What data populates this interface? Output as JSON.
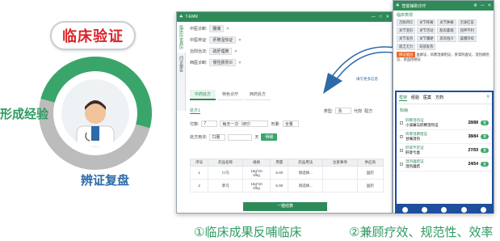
{
  "slide": {
    "title": "临床验证",
    "label_left": "形成经验",
    "label_bottom": "辨证复盘",
    "caption1": "①临床成果反哺临床",
    "caption2": "②兼顾疗效、规范性、效率"
  },
  "main_window": {
    "title": "T-EMR",
    "vtabs": [
      "临床历史病历",
      "问诊报告"
    ],
    "fields": [
      {
        "label": "中医诊断:",
        "value": "腹痛"
      },
      {
        "label": "中医辨证:",
        "value": "肝脾湿热证"
      },
      {
        "label": "治则治法:",
        "value": "疏肝理脾"
      },
      {
        "label": "西医诊断:",
        "value": "慢性肠胃炎"
      }
    ],
    "more_link": "填写更多信息",
    "rx_tabs": [
      "中药处方",
      "特色诊疗",
      "西药处方"
    ],
    "rx_label": "处方1",
    "type_label": "类型:",
    "type_value": "汤",
    "opts": [
      "代煎",
      "配方"
    ],
    "dose_label": "付数:",
    "dose_value": "7",
    "freq_label": "每天一次（8时）",
    "amount_label": "剂量:",
    "amount_value": "全量",
    "usage_label": "处方用法:",
    "usage_value": "口服",
    "days_label": "天",
    "add_btn": "明细",
    "columns": [
      "序号",
      "药品名称",
      "规格",
      "用量",
      "药品用法",
      "注意事项",
      "供应商"
    ],
    "rows": [
      {
        "no": "1",
        "name": "川乌",
        "spec": "15g*10\n0/kg",
        "qty": "6.00",
        "usage": "请选择...",
        "note": "",
        "vendor": "国药"
      },
      {
        "no": "2",
        "name": "草乌",
        "spec": "15g*10\n0/kg",
        "qty": "6.00",
        "usage": "请选择...",
        "note": "",
        "vendor": "国药"
      }
    ],
    "confirm_btn": "一键结算"
  },
  "right_window": {
    "title": "智能辅助诊疗",
    "section": "临床表现",
    "tags": [
      "舌脉四诊",
      "关节疼痛",
      "关节肿痛",
      "舌质红苔",
      "关节变形",
      "关节活动",
      "肌肉萎缩",
      "屈伸不利",
      "关节发热",
      "关节僵硬",
      "恶风怕冷",
      "晨僵持续",
      "疲乏无力",
      "局部发热"
    ],
    "highlight_tag": "辨证施治",
    "text": "血痹证、风寒湿痹阻证、肝肾阴虚证、湿热痹阻证、瘀血阻络证",
    "panel_tabs": [
      "框架",
      "经验",
      "医案",
      "方药"
    ],
    "panel_section": "知病",
    "items": [
      {
        "title": "肝脾湿热证",
        "desc": "小溪痛与肝脾湿热证",
        "score": "28/88",
        "btn": "查"
      },
      {
        "title": "风寒湿痹阻证",
        "desc": "甘痛湿热",
        "score": "38/84",
        "btn": "查"
      },
      {
        "title": "肝肾不足证",
        "desc": "肝肾亏虚",
        "score": "27/59",
        "btn": "查"
      },
      {
        "title": "湿热蕴结证",
        "desc": "湿热蕴结",
        "score": "24/54",
        "btn": "查"
      }
    ]
  },
  "colors": {
    "green": "#2e8b57",
    "red": "#d9232a",
    "blue": "#1f4e9c",
    "gray": "#bcbcbc"
  }
}
